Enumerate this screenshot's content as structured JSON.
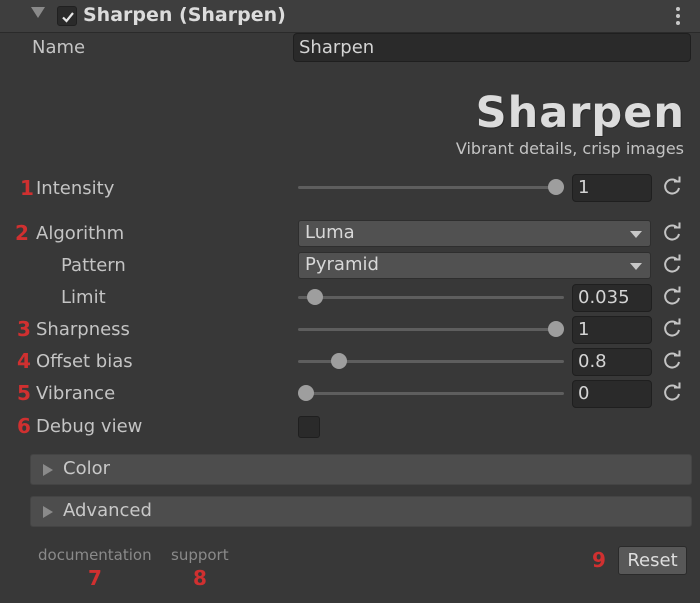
{
  "header": {
    "title": "Sharpen (Sharpen)",
    "enabled": true
  },
  "name_field": {
    "label": "Name",
    "value": "Sharpen"
  },
  "logo": {
    "text": "Sharpen",
    "tagline": "Vibrant details, crisp images"
  },
  "properties": {
    "intensity": {
      "marker": "1",
      "label": "Intensity",
      "value": "1",
      "slider_fraction": 1.0
    },
    "algorithm": {
      "marker": "2",
      "label": "Algorithm",
      "selected": "Luma"
    },
    "pattern": {
      "label": "Pattern",
      "selected": "Pyramid"
    },
    "limit": {
      "label": "Limit",
      "value": "0.035",
      "slider_fraction": 0.035
    },
    "sharpness": {
      "marker": "3",
      "label": "Sharpness",
      "value": "1",
      "slider_fraction": 1.0
    },
    "offset_bias": {
      "marker": "4",
      "label": "Offset bias",
      "value": "0.8",
      "slider_fraction": 0.16
    },
    "vibrance": {
      "marker": "5",
      "label": "Vibrance",
      "value": "0",
      "slider_fraction": 0.0
    },
    "debug_view": {
      "marker": "6",
      "label": "Debug view",
      "checked": false
    }
  },
  "sections": {
    "color": "Color",
    "advanced": "Advanced"
  },
  "footer": {
    "documentation": "documentation",
    "documentation_marker": "7",
    "support": "support",
    "support_marker": "8",
    "reset_marker": "9",
    "reset_label": "Reset"
  },
  "colors": {
    "background": "#383838",
    "marker": "#d03030",
    "field": "#2a2a2a"
  },
  "icons": {
    "foldout": "triangle-down-icon",
    "enabled": "checkmark-icon",
    "menu": "kebab-menu-icon",
    "reset": "refresh-icon",
    "dropdown": "caret-down-icon",
    "section": "triangle-right-icon"
  }
}
